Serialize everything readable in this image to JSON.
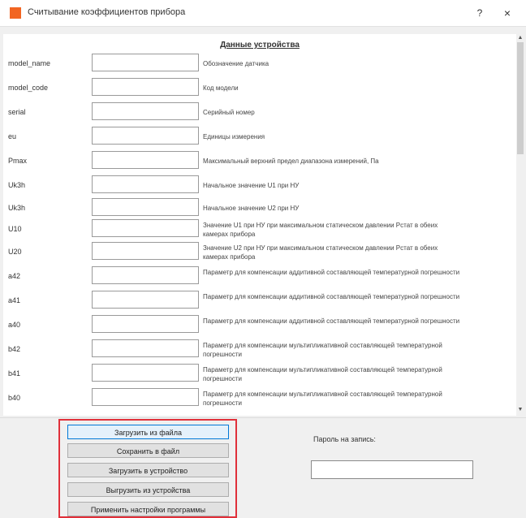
{
  "window": {
    "title": "Считывание коэффициентов прибора",
    "help_label": "?",
    "close_label": "×",
    "accent": "#f26522"
  },
  "section": {
    "title": "Данные устройства"
  },
  "params": [
    {
      "name": "model_name",
      "value": "",
      "desc": "Обозначение датчика"
    },
    {
      "name": "model_code",
      "value": "",
      "desc": "Код модели"
    },
    {
      "name": "serial",
      "value": "",
      "desc": "Серийный номер"
    },
    {
      "name": "eu",
      "value": "",
      "desc": "Единицы измерения"
    },
    {
      "name": "Pmax",
      "value": "",
      "desc": "Максимальный верхний предел диапазона измерений, Па"
    },
    {
      "name": "Uk3h",
      "value": "",
      "desc": "Начальное значение U1 при НУ"
    },
    {
      "name": "Uk3h",
      "value": "",
      "desc": "Начальное значение U2 при НУ"
    },
    {
      "name": "U10",
      "value": "",
      "desc": "Значение U1 при НУ при максимальном статическом давлении Рстат в обеих камерах прибора"
    },
    {
      "name": "U20",
      "value": "",
      "desc": "Значение U2 при НУ при максимальном статическом давлении Рстат в обеих камерах прибора"
    },
    {
      "name": "a42",
      "value": "",
      "desc": "Параметр для компенсации аддитивной составляющей температурной погрешности"
    },
    {
      "name": "a41",
      "value": "",
      "desc": "Параметр для компенсации аддитивной составляющей температурной погрешности"
    },
    {
      "name": "a40",
      "value": "",
      "desc": "Параметр для компенсации аддитивной составляющей температурной погрешности"
    },
    {
      "name": "b42",
      "value": "",
      "desc": "Параметр для компенсации мультипликативной составляющей температурной погрешности"
    },
    {
      "name": "b41",
      "value": "",
      "desc": "Параметр для компенсации мультипликативной составляющей температурной погрешности"
    },
    {
      "name": "b40",
      "value": "",
      "desc": "Параметр для компенсации мультипликативной составляющей температурной погрешности"
    }
  ],
  "buttons": {
    "load_file": "Загрузить из файла",
    "save_file": "Сохранить в файл",
    "load_device": "Загрузить в устройство",
    "unload_device": "Выгрузить из устройства",
    "apply_settings": "Применить настройки программы"
  },
  "password": {
    "label": "Пароль на запись:",
    "value": ""
  },
  "scrollbar": {
    "up": "▲",
    "down": "▼"
  }
}
